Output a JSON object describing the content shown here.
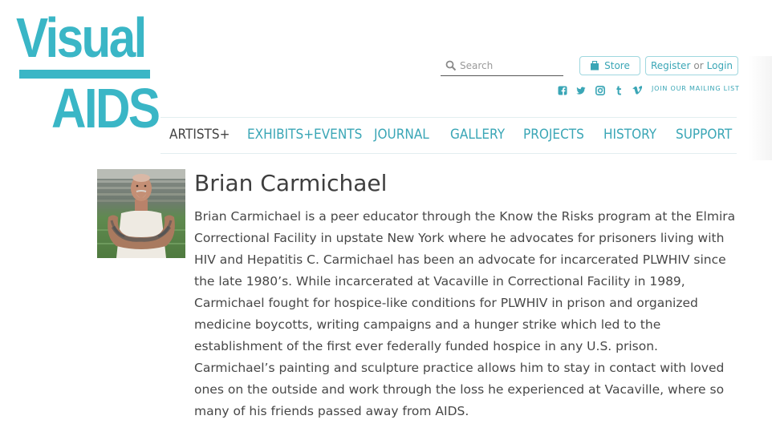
{
  "logo": {
    "line1": "Visual",
    "line2": "AIDS"
  },
  "header": {
    "search": {
      "placeholder": "Search",
      "value": ""
    },
    "store_label": "Store",
    "register_label": "Register",
    "or_label": "or",
    "login_label": "Login",
    "social_icons": [
      "facebook-icon",
      "twitter-icon",
      "instagram-icon",
      "tumblr-icon",
      "vimeo-icon"
    ],
    "mailing_label": "JOIN OUR MAILING LIST"
  },
  "nav": {
    "items": [
      {
        "label": "ARTISTS+",
        "active": true
      },
      {
        "label": "EXHIBITS+EVENTS",
        "active": false
      },
      {
        "label": "JOURNAL",
        "active": false
      },
      {
        "label": "GALLERY",
        "active": false
      },
      {
        "label": "PROJECTS",
        "active": false
      },
      {
        "label": "HISTORY",
        "active": false
      },
      {
        "label": "SUPPORT",
        "active": false
      }
    ]
  },
  "artist": {
    "name": "Brian Carmichael",
    "bio": "Brian Carmichael is a peer educator through the Know the Risks program at the Elmira Correctional Facility in upstate New York where he advocates for prisoners living with HIV and Hepatitis C. Carmichael has been an advocate for incarcerated PLWHIV since the late 1980’s. While incarcerated at Vacaville in Correctional Facility in 1989, Carmichael fought for hospice-like conditions for PLWHIV in prison and organized medicine boycotts, writing campaigns and a hunger strike which led to the establishment of the first ever federally funded hospice in any U.S. prison. Carmichael’s painting and sculpture practice allows him to stay in contact with loved ones on the outside and work through the loss he experienced at Vacaville, where so many of his friends passed away from AIDS."
  },
  "colors": {
    "accent": "#3ab6c6",
    "link": "#3aa6b6",
    "text": "#474747"
  }
}
